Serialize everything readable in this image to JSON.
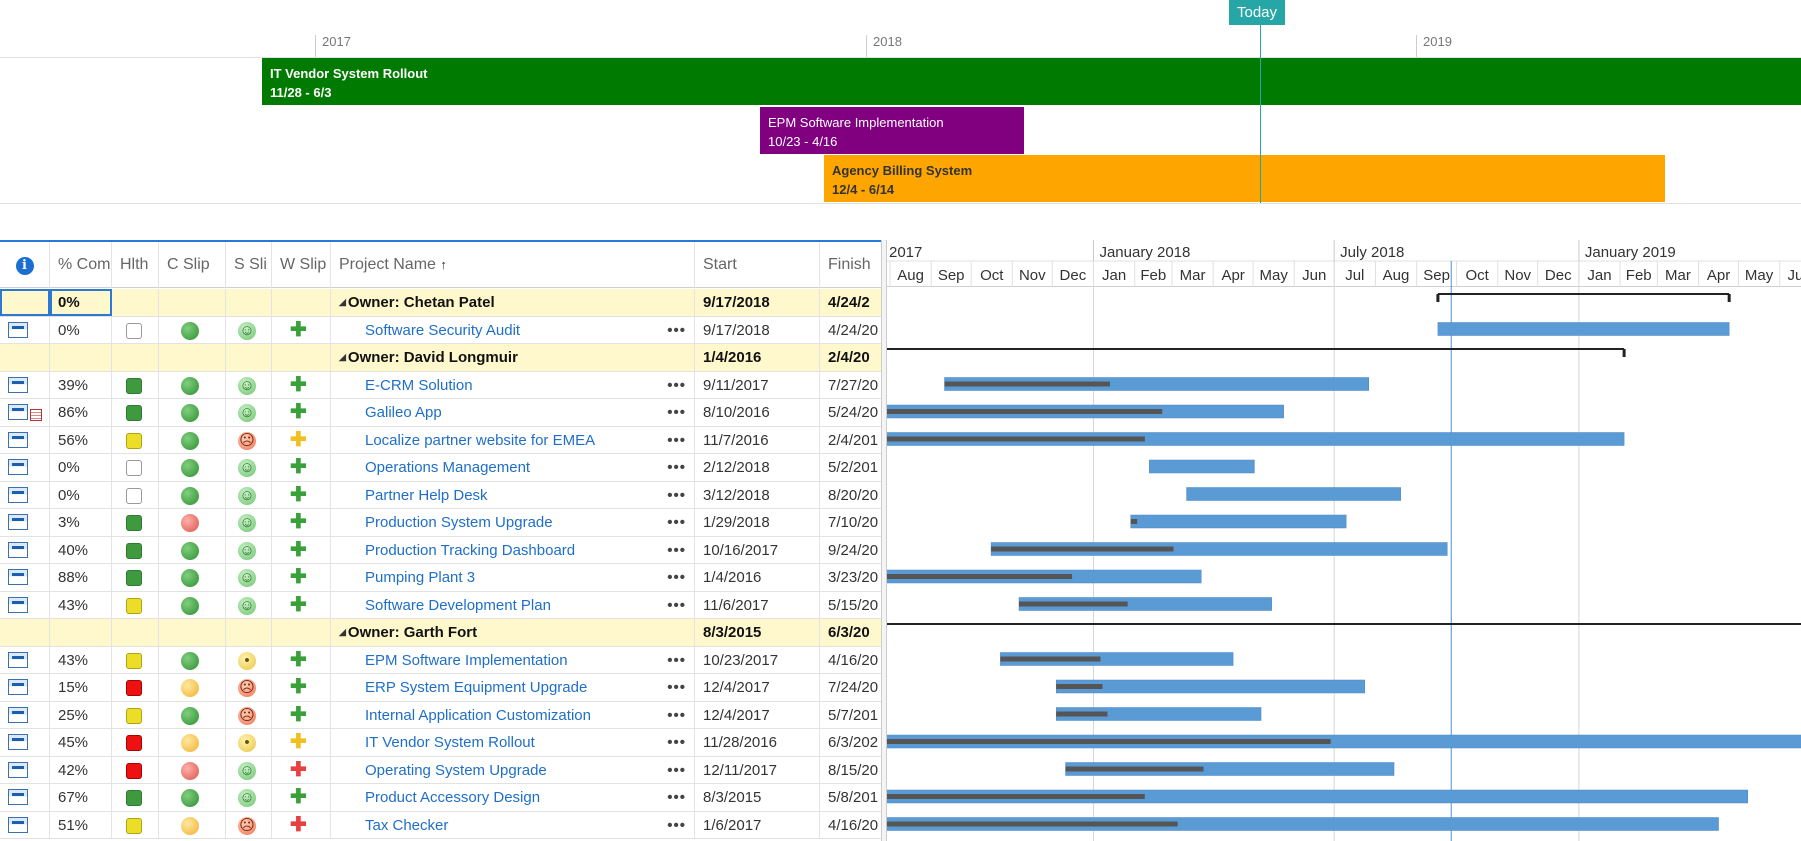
{
  "timeline": {
    "years": [
      "2017",
      "2018",
      "2019"
    ],
    "today_label": "Today",
    "bars": [
      {
        "name": "IT Vendor System Rollout",
        "dates": "11/28 - 6/3",
        "color": "#007a00"
      },
      {
        "name": "EPM Software Implementation",
        "dates": "10/23 - 4/16",
        "color": "#800080"
      },
      {
        "name": "Agency Billing System",
        "dates": "12/4 - 6/14",
        "color": "#ffa500"
      }
    ]
  },
  "grid": {
    "columns": [
      "% Com",
      "Hlth",
      "C Slip",
      "S Sli",
      "W Slip",
      "Project Name",
      "Start",
      "Finish"
    ],
    "sort_arrow": "↑",
    "rows": [
      {
        "type": "group",
        "pct": "0%",
        "name": "Owner: Chetan Patel",
        "start": "9/17/2018",
        "finish": "4/24/2"
      },
      {
        "type": "item",
        "pct": "0%",
        "health": "empty",
        "cslip": "green",
        "sslip": "smile",
        "wslip": "green",
        "name": "Software Security Audit",
        "start": "9/17/2018",
        "finish": "4/24/20",
        "note": false
      },
      {
        "type": "group",
        "pct": "",
        "name": "Owner: David Longmuir",
        "start": "1/4/2016",
        "finish": "2/4/20"
      },
      {
        "type": "item",
        "pct": "39%",
        "health": "green",
        "cslip": "green",
        "sslip": "smile",
        "wslip": "green",
        "name": "E-CRM Solution",
        "start": "9/11/2017",
        "finish": "7/27/20",
        "note": false
      },
      {
        "type": "item",
        "pct": "86%",
        "health": "green",
        "cslip": "green",
        "sslip": "smile",
        "wslip": "green",
        "name": "Galileo App",
        "start": "8/10/2016",
        "finish": "5/24/20",
        "note": true
      },
      {
        "type": "item",
        "pct": "56%",
        "health": "yellow",
        "cslip": "green",
        "sslip": "frown",
        "wslip": "yellow",
        "name": "Localize partner website for EMEA",
        "start": "11/7/2016",
        "finish": "2/4/201",
        "note": false
      },
      {
        "type": "item",
        "pct": "0%",
        "health": "empty",
        "cslip": "green",
        "sslip": "smile",
        "wslip": "green",
        "name": "Operations Management",
        "start": "2/12/2018",
        "finish": "5/2/201",
        "note": false
      },
      {
        "type": "item",
        "pct": "0%",
        "health": "empty",
        "cslip": "green",
        "sslip": "smile",
        "wslip": "green",
        "name": "Partner Help Desk",
        "start": "3/12/2018",
        "finish": "8/20/20",
        "note": false
      },
      {
        "type": "item",
        "pct": "3%",
        "health": "green",
        "cslip": "red",
        "sslip": "smile",
        "wslip": "green",
        "name": "Production System Upgrade",
        "start": "1/29/2018",
        "finish": "7/10/20",
        "note": false
      },
      {
        "type": "item",
        "pct": "40%",
        "health": "green",
        "cslip": "green",
        "sslip": "smile",
        "wslip": "green",
        "name": "Production Tracking Dashboard",
        "start": "10/16/2017",
        "finish": "9/24/20",
        "note": false
      },
      {
        "type": "item",
        "pct": "88%",
        "health": "green",
        "cslip": "green",
        "sslip": "smile",
        "wslip": "green",
        "name": "Pumping Plant 3",
        "start": "1/4/2016",
        "finish": "3/23/20",
        "note": false
      },
      {
        "type": "item",
        "pct": "43%",
        "health": "yellow",
        "cslip": "green",
        "sslip": "smile",
        "wslip": "green",
        "name": "Software Development Plan",
        "start": "11/6/2017",
        "finish": "5/15/20",
        "note": false
      },
      {
        "type": "group",
        "pct": "",
        "name": "Owner: Garth Fort",
        "start": "8/3/2015",
        "finish": "6/3/20"
      },
      {
        "type": "item",
        "pct": "43%",
        "health": "yellow",
        "cslip": "green",
        "sslip": "neutral",
        "wslip": "green",
        "name": "EPM Software Implementation",
        "start": "10/23/2017",
        "finish": "4/16/20",
        "note": false
      },
      {
        "type": "item",
        "pct": "15%",
        "health": "red",
        "cslip": "yellow",
        "sslip": "frown",
        "wslip": "green",
        "name": "ERP System Equipment Upgrade",
        "start": "12/4/2017",
        "finish": "7/24/20",
        "note": false
      },
      {
        "type": "item",
        "pct": "25%",
        "health": "yellow",
        "cslip": "green",
        "sslip": "frown",
        "wslip": "green",
        "name": "Internal Application Customization",
        "start": "12/4/2017",
        "finish": "5/7/201",
        "note": false
      },
      {
        "type": "item",
        "pct": "45%",
        "health": "red",
        "cslip": "yellow",
        "sslip": "neutral",
        "wslip": "yellow",
        "name": "IT Vendor System Rollout",
        "start": "11/28/2016",
        "finish": "6/3/202",
        "note": false
      },
      {
        "type": "item",
        "pct": "42%",
        "health": "red",
        "cslip": "red",
        "sslip": "smile",
        "wslip": "red",
        "name": "Operating System Upgrade",
        "start": "12/11/2017",
        "finish": "8/15/20",
        "note": false
      },
      {
        "type": "item",
        "pct": "67%",
        "health": "green",
        "cslip": "green",
        "sslip": "smile",
        "wslip": "green",
        "name": "Product Accessory Design",
        "start": "8/3/2015",
        "finish": "5/8/201",
        "note": false
      },
      {
        "type": "item",
        "pct": "51%",
        "health": "yellow",
        "cslip": "yellow",
        "sslip": "frown",
        "wslip": "red",
        "name": "Tax Checker",
        "start": "1/6/2017",
        "finish": "4/16/20",
        "note": false
      }
    ]
  },
  "gantt": {
    "top_labels": [
      "2017",
      "January 2018",
      "July 2018",
      "January 2019"
    ],
    "months": [
      "Aug",
      "Sep",
      "Oct",
      "Nov",
      "Dec",
      "Jan",
      "Feb",
      "Mar",
      "Apr",
      "May",
      "Jun",
      "Jul",
      "Aug",
      "Sep",
      "Oct",
      "Nov",
      "Dec",
      "Jan",
      "Feb",
      "Mar",
      "Apr",
      "May",
      "Jun"
    ],
    "bar_color": "#5b9bd5",
    "progress_color": "#555555",
    "rows": [
      {
        "type": "summary",
        "start": "2018-09-17",
        "end": "2019-04-24"
      },
      {
        "type": "task",
        "start": "2018-09-17",
        "end": "2019-04-24",
        "pct": 0
      },
      {
        "type": "summary",
        "start": "2016-01-04",
        "end": "2019-02-04"
      },
      {
        "type": "task",
        "start": "2017-09-11",
        "end": "2018-07-27",
        "pct": 39
      },
      {
        "type": "task",
        "start": "2016-08-10",
        "end": "2018-05-24",
        "pct": 86
      },
      {
        "type": "task",
        "start": "2016-11-07",
        "end": "2019-02-04",
        "pct": 56
      },
      {
        "type": "task",
        "start": "2018-02-12",
        "end": "2018-05-02",
        "pct": 0
      },
      {
        "type": "task",
        "start": "2018-03-12",
        "end": "2018-08-20",
        "pct": 0
      },
      {
        "type": "task",
        "start": "2018-01-29",
        "end": "2018-07-10",
        "pct": 3
      },
      {
        "type": "task",
        "start": "2017-10-16",
        "end": "2018-09-24",
        "pct": 40
      },
      {
        "type": "task",
        "start": "2016-01-04",
        "end": "2018-03-23",
        "pct": 88
      },
      {
        "type": "task",
        "start": "2017-11-06",
        "end": "2018-05-15",
        "pct": 43
      },
      {
        "type": "summary",
        "start": "2015-08-03",
        "end": "2020-06-03"
      },
      {
        "type": "task",
        "start": "2017-10-23",
        "end": "2018-04-16",
        "pct": 43
      },
      {
        "type": "task",
        "start": "2017-12-04",
        "end": "2018-07-24",
        "pct": 15
      },
      {
        "type": "task",
        "start": "2017-12-04",
        "end": "2018-05-07",
        "pct": 25
      },
      {
        "type": "task",
        "start": "2016-11-28",
        "end": "2020-06-03",
        "pct": 45
      },
      {
        "type": "task",
        "start": "2017-12-11",
        "end": "2018-08-15",
        "pct": 42
      },
      {
        "type": "task",
        "start": "2015-08-03",
        "end": "2019-05-08",
        "pct": 67
      },
      {
        "type": "task",
        "start": "2017-01-06",
        "end": "2019-04-16",
        "pct": 51
      }
    ]
  }
}
